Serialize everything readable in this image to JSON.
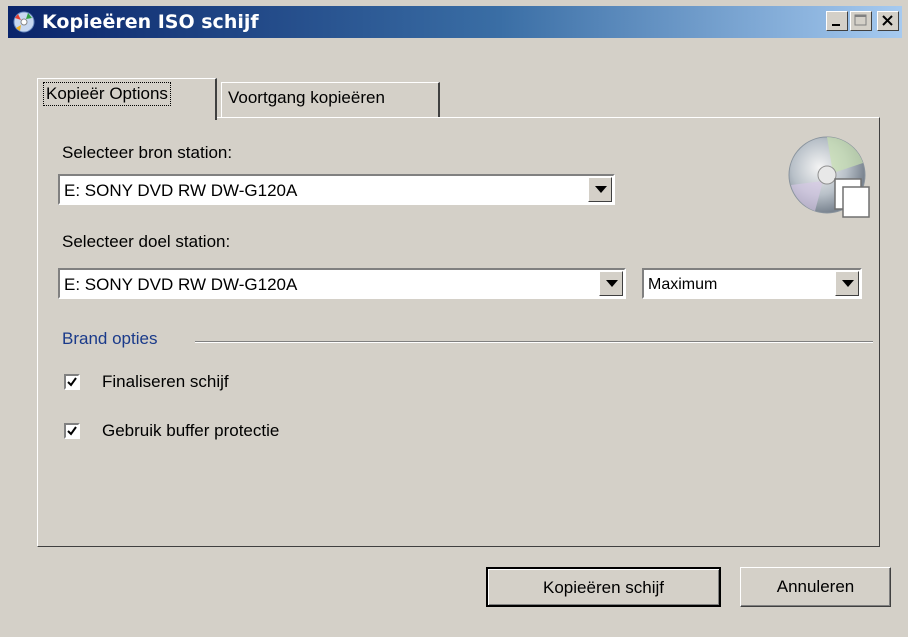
{
  "window": {
    "title": "Kopieëren ISO schijf",
    "icon": "cd-copy-app-icon",
    "controls": [
      "minimize",
      "maximize",
      "close"
    ]
  },
  "tabs": [
    {
      "label": "Kopieër Options",
      "active": true
    },
    {
      "label": "Voortgang kopieëren",
      "active": false
    }
  ],
  "source": {
    "label": "Selecteer bron station:",
    "value": "E: SONY DVD RW DW-G120A"
  },
  "target": {
    "label": "Selecteer doel station:",
    "value": "E: SONY DVD RW DW-G120A",
    "speed": "Maximum"
  },
  "burn_options": {
    "title": "Brand opties",
    "finalize": {
      "label": "Finaliseren schijf",
      "checked": true
    },
    "buffer": {
      "label": "Gebruik buffer protectie",
      "checked": true
    }
  },
  "buttons": {
    "copy": "Kopieëren schijf",
    "cancel": "Annuleren"
  },
  "colors": {
    "titlebar_start": "#0a246a",
    "titlebar_end": "#a6caf0",
    "group_label": "#1a3a8a",
    "face": "#d4d0c8"
  }
}
